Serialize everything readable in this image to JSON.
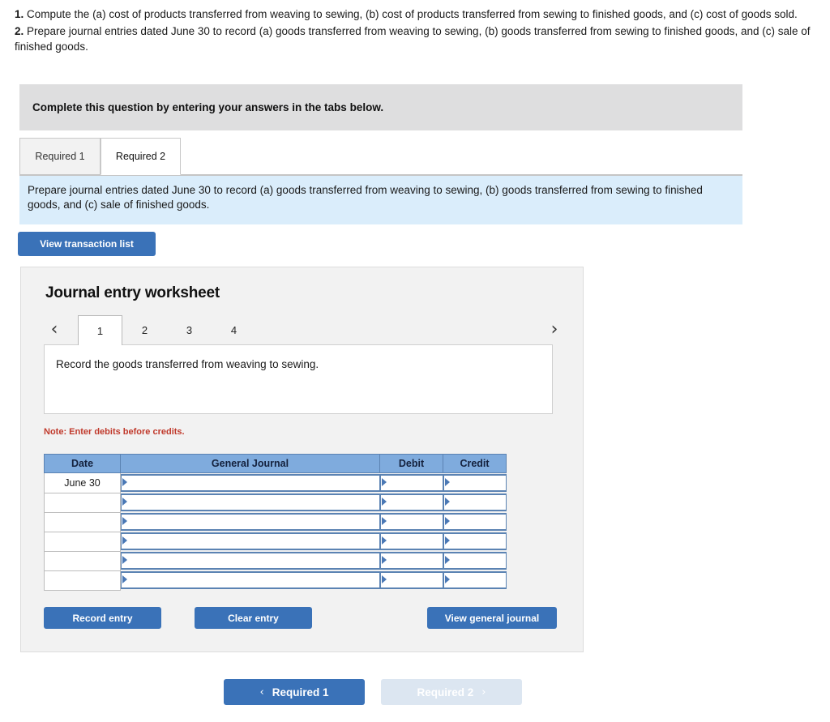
{
  "question": {
    "items": [
      {
        "num": "1.",
        "text": " Compute the (a) cost of products transferred from weaving to sewing, (b) cost of products transferred from sewing to finished goods, and (c) cost of goods sold."
      },
      {
        "num": "2.",
        "text": " Prepare journal entries dated June 30 to record (a) goods transferred from weaving to sewing, (b) goods transferred from sewing to finished goods, and (c) sale of finished goods."
      }
    ]
  },
  "banner": {
    "text": "Complete this question by entering your answers in the tabs below."
  },
  "tabs": [
    {
      "label": "Required 1",
      "active": false
    },
    {
      "label": "Required 2",
      "active": true
    }
  ],
  "instruction": {
    "text": "Prepare journal entries dated June 30 to record (a) goods transferred from weaving to sewing, (b) goods transferred from sewing to finished goods, and (c) sale of finished goods."
  },
  "toolbar": {
    "view_transaction_list": "View transaction list"
  },
  "worksheet": {
    "title": "Journal entry worksheet",
    "pager": {
      "prev_icon": "chevron-left",
      "next_icon": "chevron-right",
      "prev_glyph": "‹",
      "next_glyph": "›",
      "pages": [
        "1",
        "2",
        "3",
        "4"
      ],
      "active_page": "1"
    },
    "transaction_description": "Record the goods transferred from weaving to sewing.",
    "note": "Note: Enter debits before credits.",
    "table": {
      "columns": [
        "Date",
        "General Journal",
        "Debit",
        "Credit"
      ],
      "rows": [
        {
          "date": "June 30",
          "general_journal": "",
          "debit": "",
          "credit": ""
        },
        {
          "date": "",
          "general_journal": "",
          "debit": "",
          "credit": ""
        },
        {
          "date": "",
          "general_journal": "",
          "debit": "",
          "credit": ""
        },
        {
          "date": "",
          "general_journal": "",
          "debit": "",
          "credit": ""
        },
        {
          "date": "",
          "general_journal": "",
          "debit": "",
          "credit": ""
        },
        {
          "date": "",
          "general_journal": "",
          "debit": "",
          "credit": ""
        }
      ]
    },
    "actions": {
      "record_entry": "Record entry",
      "clear_entry": "Clear entry",
      "view_general_journal": "View general journal"
    }
  },
  "bottom_nav": {
    "prev_label": "Required 1",
    "prev_glyph": "‹",
    "next_label": "Required 2",
    "next_glyph": "›"
  },
  "colors": {
    "accent_blue": "#3a72b8",
    "table_header_blue": "#7fabdd",
    "instruction_blue": "#daedfb",
    "banner_gray": "#dededf",
    "note_red": "#c0392b",
    "disabled_blue": "#dce6f1"
  }
}
